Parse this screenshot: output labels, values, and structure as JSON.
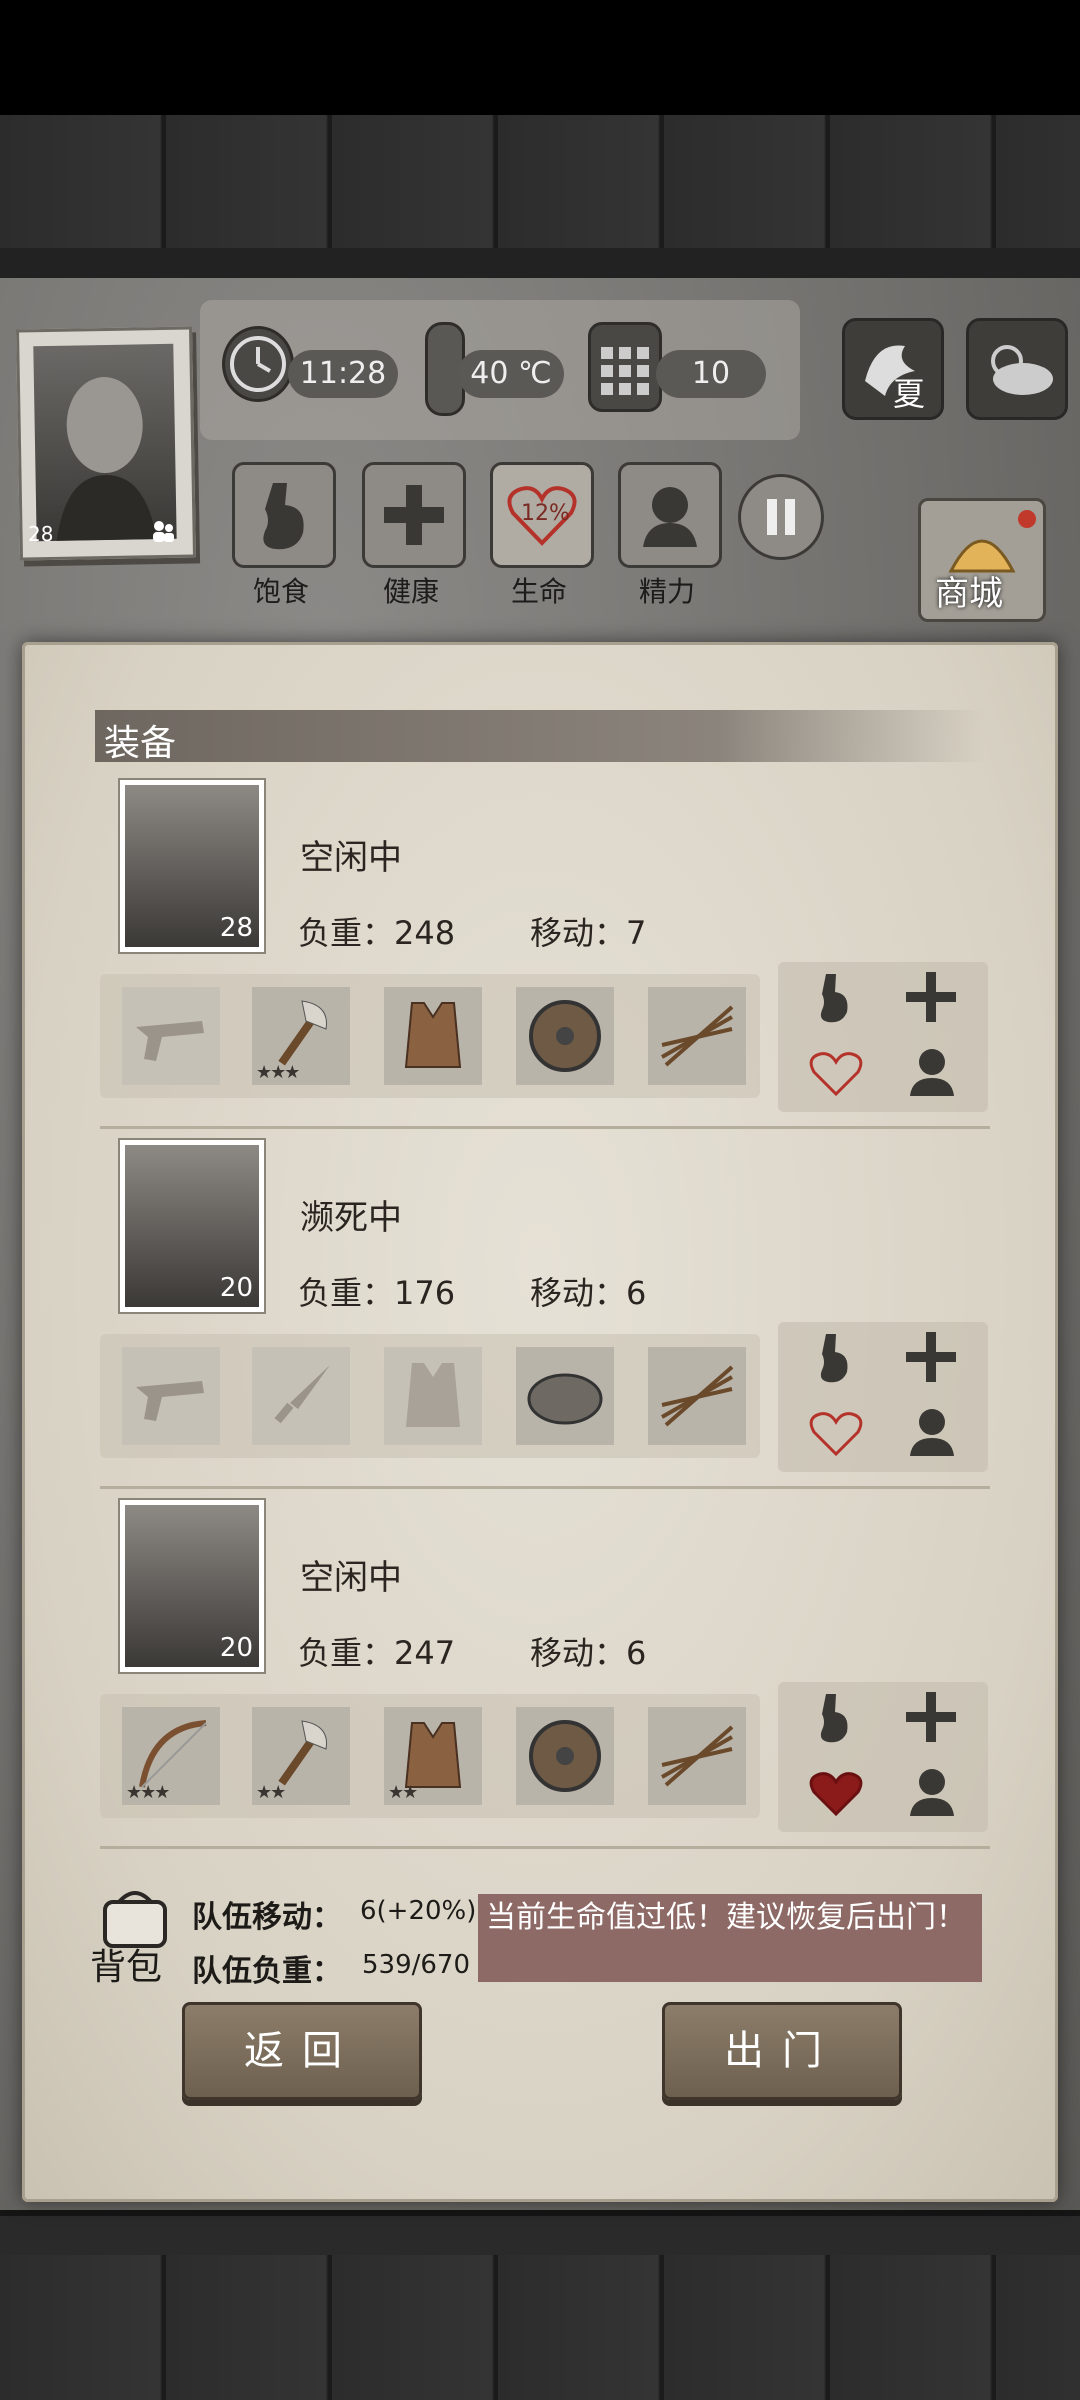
{
  "hud": {
    "time": "11:28",
    "temperature": "40 ℃",
    "day": "10",
    "season": "夏",
    "character_level": "28",
    "needs": [
      {
        "label": "饱食",
        "icon": "stomach-icon"
      },
      {
        "label": "健康",
        "icon": "plus-icon"
      },
      {
        "label": "生命",
        "icon": "heart-icon",
        "value": "12%"
      },
      {
        "label": "精力",
        "icon": "stamina-icon"
      }
    ],
    "shop_label": "商城"
  },
  "panel": {
    "title": "装备",
    "members": [
      {
        "status": "空闲中",
        "level": "28",
        "load": "负重：248",
        "move": "移动：7",
        "slots": [
          {
            "icon": "pistol-icon",
            "empty": true,
            "stars": 0
          },
          {
            "icon": "axe-icon",
            "empty": false,
            "stars": 3
          },
          {
            "icon": "vest-icon",
            "empty": false,
            "stars": 0
          },
          {
            "icon": "shield-icon",
            "empty": false,
            "stars": 0
          },
          {
            "icon": "arrows-icon",
            "empty": false,
            "stars": 0
          }
        ],
        "heart": "outline"
      },
      {
        "status": "濒死中",
        "level": "20",
        "load": "负重：176",
        "move": "移动：6",
        "slots": [
          {
            "icon": "pistol-icon",
            "empty": true,
            "stars": 0
          },
          {
            "icon": "dagger-icon",
            "empty": true,
            "stars": 0
          },
          {
            "icon": "vest-icon",
            "empty": true,
            "stars": 0
          },
          {
            "icon": "round-shield-icon",
            "empty": false,
            "stars": 0
          },
          {
            "icon": "arrows-icon",
            "empty": false,
            "stars": 0
          }
        ],
        "heart": "outline"
      },
      {
        "status": "空闲中",
        "level": "20",
        "load": "负重：247",
        "move": "移动：6",
        "slots": [
          {
            "icon": "bow-icon",
            "empty": false,
            "stars": 3
          },
          {
            "icon": "axe-icon",
            "empty": false,
            "stars": 2
          },
          {
            "icon": "vest-icon",
            "empty": false,
            "stars": 2
          },
          {
            "icon": "shield-icon",
            "empty": false,
            "stars": 0
          },
          {
            "icon": "arrows-icon",
            "empty": false,
            "stars": 0
          }
        ],
        "heart": "filled"
      }
    ],
    "footer": {
      "bag_label": "背包",
      "team_move_label": "队伍移动：",
      "team_move_value": "6(+20%)",
      "team_load_label": "队伍负重：",
      "team_load_value": "539/670",
      "warning": "当前生命值过低！建议恢复后出门！",
      "back_label": "返回",
      "go_out_label": "出门"
    }
  },
  "colors": {
    "warning_bg": "#8e6a66",
    "heart_filled": "#8b1a1a",
    "heart_outline": "#b5322a"
  }
}
